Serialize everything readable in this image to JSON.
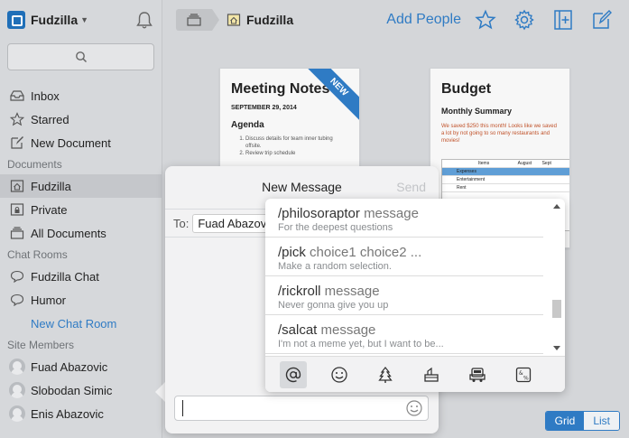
{
  "app": {
    "name": "Fudzilla"
  },
  "sidebar": {
    "main_items": [
      {
        "label": "Inbox",
        "icon": "inbox-icon"
      },
      {
        "label": "Starred",
        "icon": "star-icon"
      },
      {
        "label": "New Document",
        "icon": "compose-icon"
      }
    ],
    "documents_header": "Documents",
    "documents": [
      {
        "label": "Fudzilla",
        "icon": "home-folder-icon",
        "active": true
      },
      {
        "label": "Private",
        "icon": "lock-folder-icon"
      },
      {
        "label": "All Documents",
        "icon": "stack-icon"
      }
    ],
    "chat_header": "Chat Rooms",
    "chat_rooms": [
      {
        "label": "Fudzilla Chat"
      },
      {
        "label": "Humor"
      }
    ],
    "new_chat_room": "New Chat Room",
    "members_header": "Site Members",
    "members": [
      {
        "label": "Fuad Abazovic"
      },
      {
        "label": "Slobodan Simic"
      },
      {
        "label": "Enis Abazovic"
      }
    ]
  },
  "topbar": {
    "crumb": "Fudzilla",
    "add_people": "Add People"
  },
  "cards": {
    "meeting": {
      "title": "Meeting Notes",
      "badge": "NEW",
      "date": "SEPTEMBER 29, 2014",
      "agenda": "Agenda",
      "items": [
        "Discuss details for team inner tubing offsite.",
        "Review trip schedule"
      ]
    },
    "budget": {
      "title": "Budget",
      "subtitle": "Monthly Summary",
      "body": "We saved $250 this month! Looks like we saved a lot by not going to so many restaurants and movies!",
      "table_head": [
        "Items",
        "August",
        "Sept"
      ],
      "rows": [
        "Expenses",
        "Entertainment",
        "Rent"
      ]
    }
  },
  "view_toggle": {
    "grid": "Grid",
    "list": "List"
  },
  "message": {
    "title": "New Message",
    "send": "Send",
    "to_label": "To:",
    "recipient": "Fuad Abazovic"
  },
  "commands": [
    {
      "cmd": "/philosoraptor",
      "args": "message",
      "desc": "For the deepest questions"
    },
    {
      "cmd": "/pick",
      "args": "choice1 choice2 ...",
      "desc": "Make a random selection."
    },
    {
      "cmd": "/rickroll",
      "args": "message",
      "desc": "Never gonna give you up"
    },
    {
      "cmd": "/salcat",
      "args": "message",
      "desc": "I'm not a meme yet, but I want to be..."
    }
  ],
  "colors": {
    "accent": "#2f7bc4",
    "sidebar_bg": "#d6d8db"
  }
}
